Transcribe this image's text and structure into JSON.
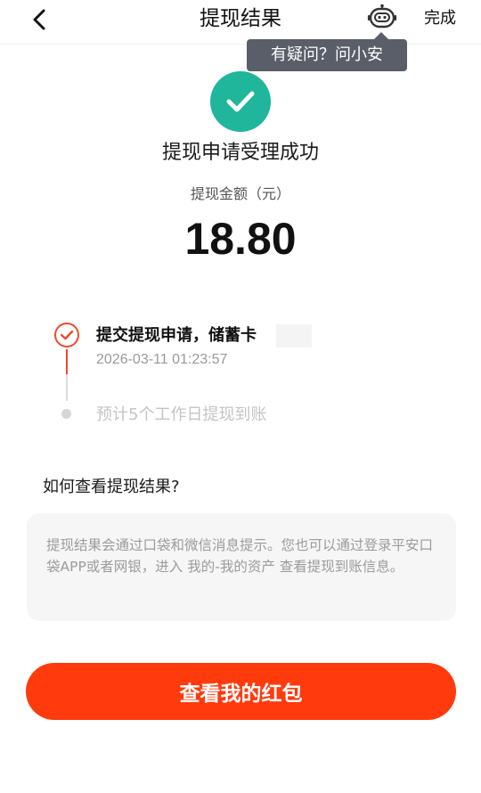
{
  "header": {
    "title": "提现结果",
    "back_icon": "chevron-left-icon",
    "assistant_icon": "robot-icon",
    "done_label": "完成"
  },
  "tooltip": {
    "text": "有疑问？问小安"
  },
  "result": {
    "status_icon": "check-circle-icon",
    "status_color": "#1fb69b",
    "title": "提现申请受理成功",
    "amount_label": "提现金额（元）",
    "amount": "18.80"
  },
  "timeline": {
    "steps": [
      {
        "label": "提交提现申请，储蓄卡",
        "time": "2026-03-11 01:23:57",
        "state": "done",
        "color": "#ee4b2b"
      },
      {
        "label": "预计5个工作日提现到账",
        "state": "pending",
        "color": "#c4c4c4"
      }
    ]
  },
  "help": {
    "title": "如何查看提现结果?",
    "text": "提现结果会通过口袋和微信消息提示。您也可以通过登录平安口袋APP或者网银，进入 我的-我的资产 查看提现到账信息。"
  },
  "action": {
    "button_label": "查看我的红包",
    "button_color": "#ff3a0d"
  }
}
